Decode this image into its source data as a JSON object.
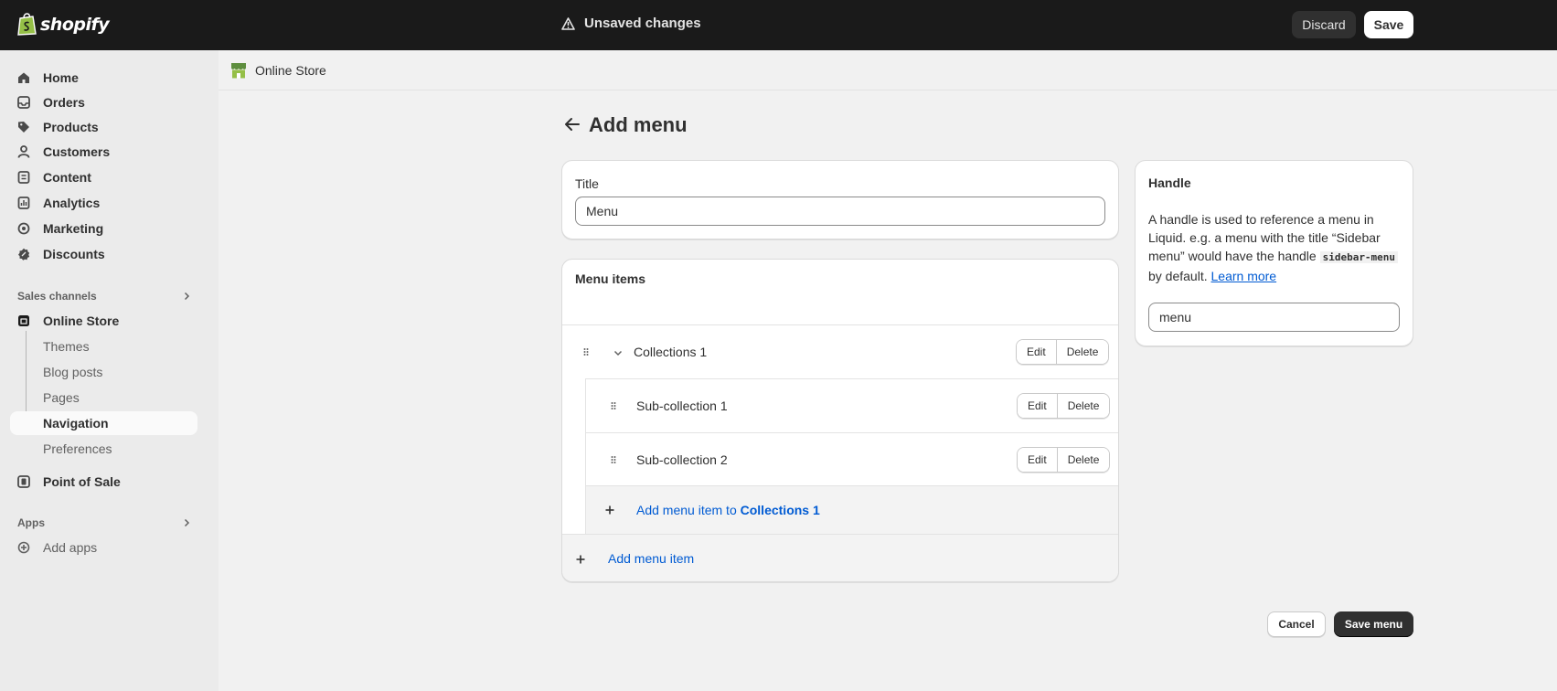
{
  "topbar": {
    "logo_text": "shopify",
    "status": "Unsaved changes",
    "discard_label": "Discard",
    "save_label": "Save"
  },
  "sidebar": {
    "main_items": [
      {
        "label": "Home",
        "icon": "home-icon"
      },
      {
        "label": "Orders",
        "icon": "inbox-icon"
      },
      {
        "label": "Products",
        "icon": "tag-icon"
      },
      {
        "label": "Customers",
        "icon": "person-icon"
      },
      {
        "label": "Content",
        "icon": "document-icon"
      },
      {
        "label": "Analytics",
        "icon": "bar-chart-icon"
      },
      {
        "label": "Marketing",
        "icon": "target-icon"
      },
      {
        "label": "Discounts",
        "icon": "discount-icon"
      }
    ],
    "sales_channels_heading": "Sales channels",
    "online_store": "Online Store",
    "online_store_sub": [
      "Themes",
      "Blog posts",
      "Pages",
      "Navigation",
      "Preferences"
    ],
    "active_sub": "Navigation",
    "point_of_sale": "Point of Sale",
    "apps_heading": "Apps",
    "add_apps": "Add apps"
  },
  "main": {
    "breadcrumb": "Online Store",
    "page_title": "Add menu",
    "title_card": {
      "label": "Title",
      "value": "Menu"
    },
    "menu_items_card": {
      "heading": "Menu items",
      "parent": {
        "label": "Collections 1"
      },
      "children": [
        {
          "label": "Sub-collection 1"
        },
        {
          "label": "Sub-collection 2"
        }
      ],
      "edit_label": "Edit",
      "delete_label": "Delete",
      "add_sub_prefix": "Add menu item to ",
      "add_sub_target": "Collections 1",
      "add_item_label": "Add menu item"
    },
    "handle_card": {
      "heading": "Handle",
      "desc_1": "A handle is used to reference a menu in Liquid. e.g. a menu with the title “Sidebar menu” would have the handle ",
      "code": "sidebar-menu",
      "desc_2": " by default. ",
      "learn_more": "Learn more",
      "value": "menu"
    },
    "cancel_label": "Cancel",
    "save_menu_label": "Save menu"
  },
  "colors": {
    "topbar_bg": "#1a1a1a",
    "link": "#005bd3",
    "primary_button": "#303030"
  }
}
